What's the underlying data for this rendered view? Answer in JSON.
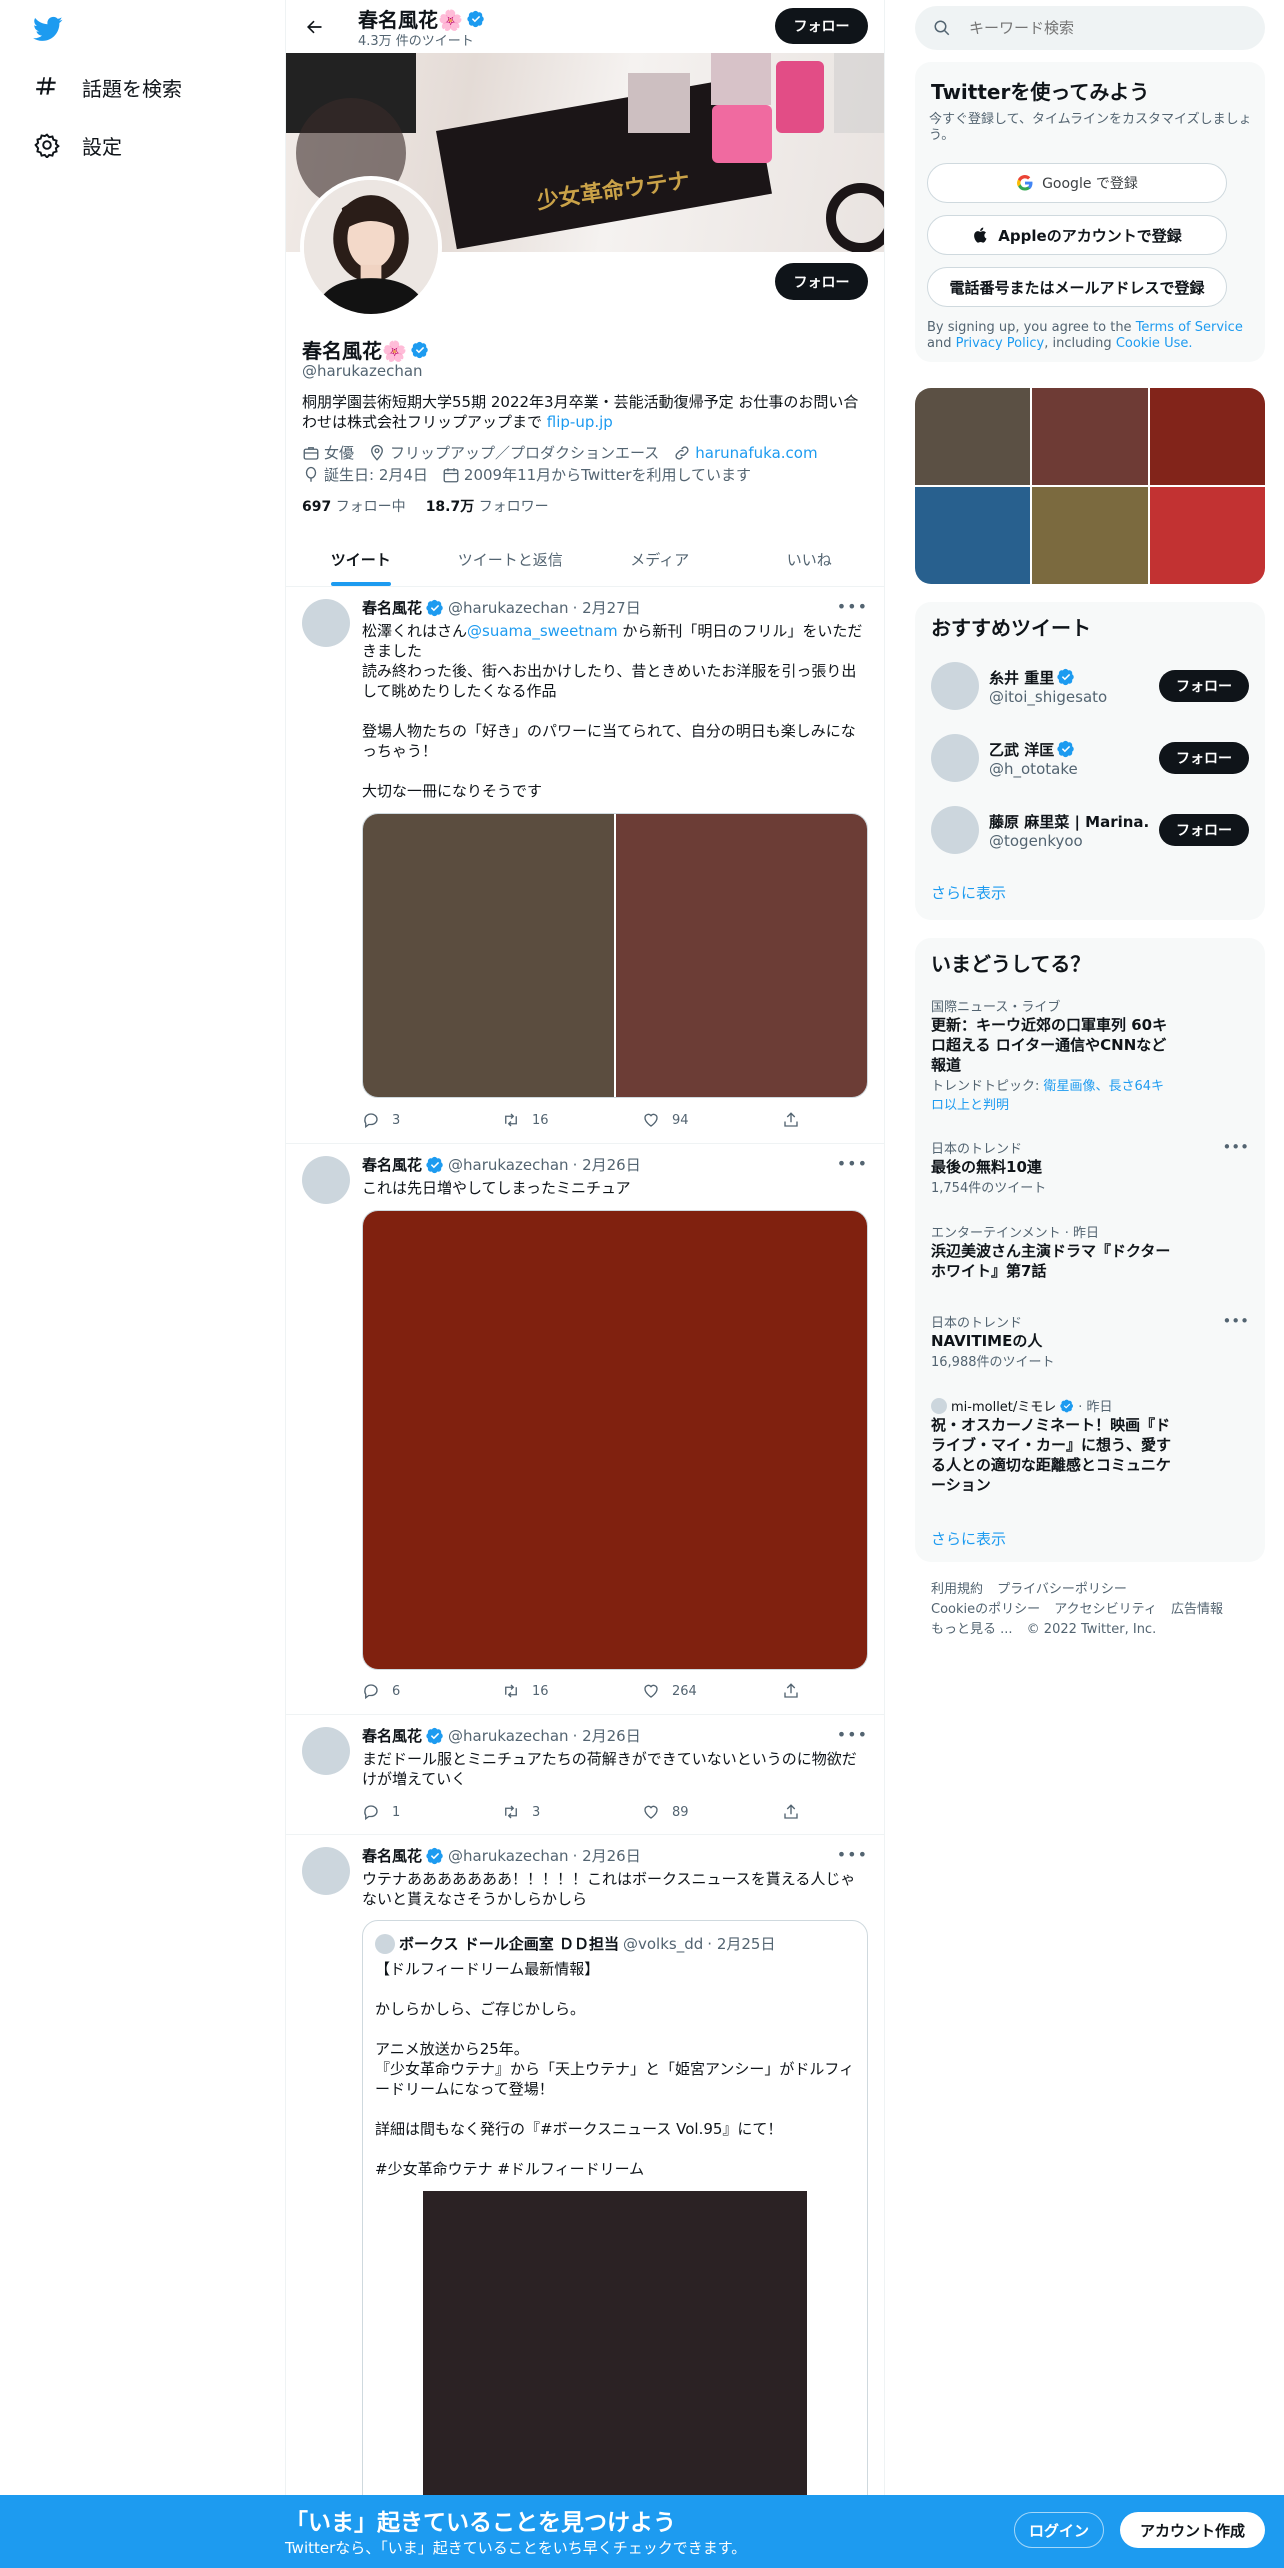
{
  "nav": {
    "explore_label": "話題を検索",
    "settings_label": "設定"
  },
  "header": {
    "name": "春名風花🌸",
    "tweet_count": "4.3万 件のツイート",
    "follow_label": "フォロー"
  },
  "banner": {
    "label": "少女革命ウテナ"
  },
  "profile": {
    "name": "春名風花🌸",
    "handle": "@harukazechan",
    "bio": "桐朋学園芸術短期大学55期 2022年3月卒業・芸能活動復帰予定 お仕事のお問い合わせは株式会社フリップアップまで ",
    "bio_link": "flip-up.jp",
    "follow_label": "フォロー",
    "occupation": "女優",
    "location": "フリップアップ／プロダクションエース",
    "website": "harunafuka.com",
    "birthday": "誕生日: 2月4日",
    "joined": "2009年11月からTwitterを利用しています",
    "following_count": "697",
    "following_label": "フォロー中",
    "followers_count": "18.7万",
    "followers_label": "フォロワー"
  },
  "tabs": [
    "ツイート",
    "ツイートと返信",
    "メディア",
    "いいね"
  ],
  "tweets": [
    {
      "name": "春名風花",
      "handle": "@harukazechan",
      "date": "· 2月27日",
      "text_a": "松澤くれはさん",
      "mention": "@suama_sweetnam",
      "text_b": " から新刊「明日のフリル」をいただきました\n読み終わった後、街へお出かけしたり、昔ときめいたお洋服を引っ張り出して眺めたりしたくなる作品\n\n登場人物たちの「好き」のパワーに当てられて、自分の明日も楽しみになっちゃう！\n\n大切な一冊になりそうです",
      "replies": "3",
      "retweets": "16",
      "likes": "94",
      "media_colors": [
        "#5b4d3f",
        "#6c3d36"
      ]
    },
    {
      "name": "春名風花",
      "handle": "@harukazechan",
      "date": "· 2月26日",
      "text": "これは先日増やしてしまったミニチュア",
      "replies": "6",
      "retweets": "16",
      "likes": "264",
      "media_colors": [
        "#80210f"
      ]
    },
    {
      "name": "春名風花",
      "handle": "@harukazechan",
      "date": "· 2月26日",
      "text": "まだドール服とミニチュアたちの荷解きができていないというのに物欲だけが増えていく",
      "replies": "1",
      "retweets": "3",
      "likes": "89"
    },
    {
      "name": "春名風花",
      "handle": "@harukazechan",
      "date": "· 2月26日",
      "text": "ウテナあああああああ！！！！！これはボークスニュースを貰える人じゃないと貰えなさそうかしらかしら",
      "quote": {
        "name": "ボークス ドール企画室 ＤＤ担当",
        "handle": "@volks_dd",
        "date": "· 2月25日",
        "text": "【ドルフィードリーム最新情報】\n\nかしらかしら、ご存じかしら。\n\nアニメ放送から25年。\n『少女革命ウテナ』から「天上ウテナ」と「姫宮アンシー」がドルフィードリームになって登場！\n\n詳細は間もなく発行の『#ボークスニュース Vol.95』にて！\n\n#少女革命ウテナ #ドルフィードリーム"
      }
    }
  ],
  "sidebar": {
    "search_placeholder": "キーワード検索",
    "signup_card": {
      "title": "Twitterを使ってみよう",
      "subtitle": "今すぐ登録して、タイムラインをカスタマイズしましょう。",
      "google_label": "Google で登録",
      "apple_label": "Appleのアカウントで登録",
      "phone_label": "電話番号またはメールアドレスで登録",
      "terms_a": "By signing up, you agree to the ",
      "terms_link1": "Terms of Service",
      "terms_b": " and ",
      "terms_link2": "Privacy Policy",
      "terms_c": ", including ",
      "terms_link3": "Cookie Use."
    },
    "media_grid_colors": [
      "#5b5044",
      "#6e3b35",
      "#82241a",
      "#28608e",
      "#7b6a3f",
      "#c23232"
    ],
    "who_to_follow": {
      "title": "おすすめツイート",
      "accounts": [
        {
          "name": "糸井 重里",
          "handle": "@itoi_shigesato",
          "button": "フォロー"
        },
        {
          "name": "乙武 洋匡",
          "handle": "@h_ototake",
          "button": "フォロー"
        },
        {
          "name": "藤原 麻里菜 | Marina...",
          "handle": "@togenkyoo",
          "button": "フォロー"
        }
      ],
      "show_more": "さらに表示"
    },
    "trends": {
      "title": "いまどうしてる？",
      "items": [
        {
          "category": "国際ニュース・ライブ",
          "name": "更新：キーウ近郊の口軍車列 60キロ超える ロイター通信やCNNなど報道",
          "extra_a": "トレンドトピック: ",
          "extra_b": "衛星画像、長さ64キロ以上と判明"
        },
        {
          "category": "日本のトレンド",
          "name": "最後の無料10連",
          "count": "1,754件のツイート"
        },
        {
          "category": "エンターテインメント · 昨日",
          "name": "浜辺美波さん主演ドラマ『ドクターホワイト』第7話"
        },
        {
          "category": "日本のトレンド",
          "name": "NAVITIMEの人",
          "count": "16,988件のツイート"
        },
        {
          "source": "mi-mollet/ミモレ",
          "time": "· 昨日",
          "name": "祝・オスカーノミネート！映画『ドライブ・マイ・カー』に想う、愛する人との適切な距離感とコミュニケーション"
        }
      ],
      "show_more": "さらに表示"
    },
    "footer": [
      "利用規約",
      "プライバシーポリシー",
      "Cookieのポリシー",
      "アクセシビリティ",
      "広告情報",
      "もっと見る ...",
      "© 2022 Twitter, Inc."
    ]
  },
  "bottom_bar": {
    "title": "「いま」起きていることを見つけよう",
    "subtitle": "Twitterなら、「いま」起きていることをいち早くチェックできます。",
    "login_label": "ログイン",
    "signup_label": "アカウント作成"
  }
}
